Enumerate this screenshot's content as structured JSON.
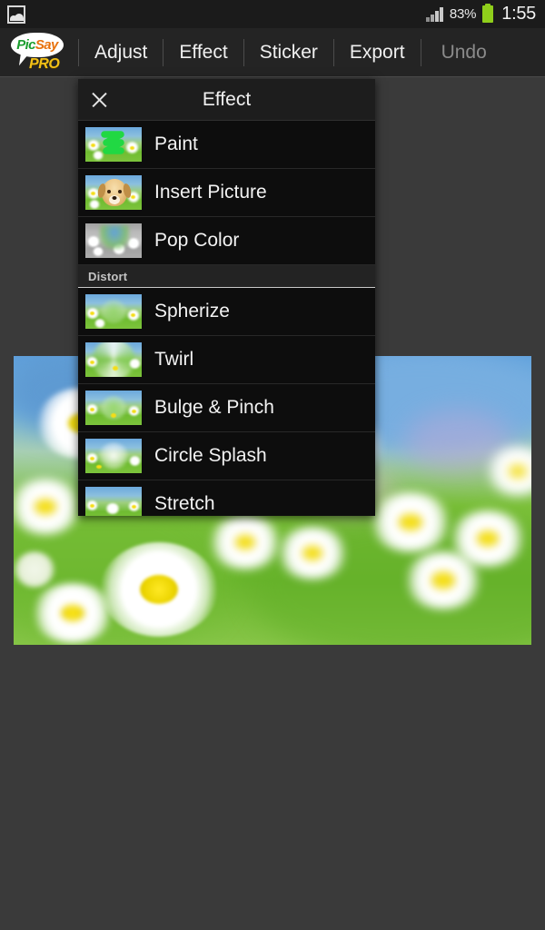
{
  "statusbar": {
    "gallery_icon": "gallery-icon",
    "signal_icon": "signal-bars-icon",
    "battery_percent": "83%",
    "battery_icon": "battery-icon",
    "time": "1:55"
  },
  "logo": {
    "pic": "Pic",
    "say": "Say",
    "pro": "PRO"
  },
  "toolbar": {
    "items": [
      {
        "label": "Adjust",
        "disabled": false
      },
      {
        "label": "Effect",
        "disabled": false
      },
      {
        "label": "Sticker",
        "disabled": false
      },
      {
        "label": "Export",
        "disabled": false
      },
      {
        "label": "Undo",
        "disabled": true
      }
    ]
  },
  "dialog": {
    "title": "Effect",
    "close_icon": "close-icon",
    "rows": [
      {
        "label": "Paint",
        "thumb": "paint-thumbnail"
      },
      {
        "label": "Insert Picture",
        "thumb": "insert-picture-thumbnail"
      },
      {
        "label": "Pop Color",
        "thumb": "pop-color-thumbnail"
      }
    ],
    "section": {
      "label": "Distort"
    },
    "distort_rows": [
      {
        "label": "Spherize",
        "thumb": "spherize-thumbnail"
      },
      {
        "label": "Twirl",
        "thumb": "twirl-thumbnail"
      },
      {
        "label": "Bulge & Pinch",
        "thumb": "bulge-pinch-thumbnail"
      },
      {
        "label": "Circle Splash",
        "thumb": "circle-splash-thumbnail"
      },
      {
        "label": "Stretch",
        "thumb": "stretch-thumbnail"
      }
    ]
  },
  "canvas": {
    "photo_alt": "daisy-field-photo"
  },
  "colors": {
    "accent_green": "#8fce1b",
    "dialog_bg": "#0d0d0d",
    "toolbar_bg": "#242424",
    "statusbar_bg": "#1b1b1b",
    "canvas_bg": "#3a3a3a",
    "disabled_text": "#8a8a8a"
  }
}
